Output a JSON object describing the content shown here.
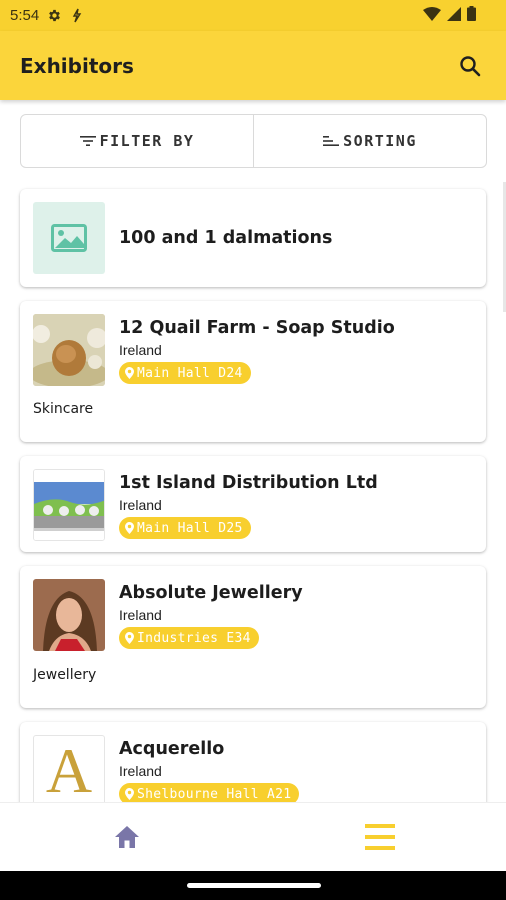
{
  "status_bar": {
    "time": "5:54"
  },
  "app_bar": {
    "title": "Exhibitors"
  },
  "filter": {
    "filter_label": "FILTER BY",
    "sort_label": "SORTING"
  },
  "exhibitors": [
    {
      "name": "100 and 1 dalmations",
      "country": "",
      "location": "",
      "category": ""
    },
    {
      "name": "12 Quail Farm - Soap Studio",
      "country": "Ireland",
      "location": "Main Hall D24",
      "category": "Skincare"
    },
    {
      "name": "1st Island Distribution Ltd",
      "country": "Ireland",
      "location": "Main Hall D25",
      "category": ""
    },
    {
      "name": "Absolute Jewellery",
      "country": "Ireland",
      "location": "Industries E34",
      "category": "Jewellery"
    },
    {
      "name": "Acquerello",
      "country": "Ireland",
      "location": "Shelbourne Hall A21",
      "category": "",
      "logo_letter": "A"
    }
  ],
  "colors": {
    "accent": "#f8cf2e",
    "app_bar": "#fbd53b",
    "nav_icon": "#7a76a8"
  }
}
